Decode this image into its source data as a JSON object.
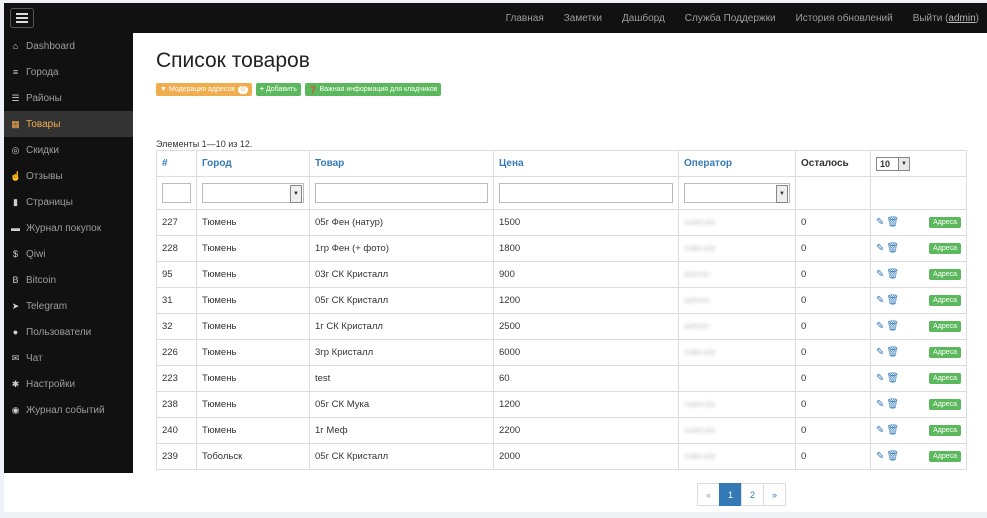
{
  "topbar": {
    "nav": [
      {
        "label": "Главная"
      },
      {
        "label": "Заметки"
      },
      {
        "label": "Дашборд"
      },
      {
        "label": "Служба Поддержки"
      },
      {
        "label": "История обновлений"
      }
    ],
    "logout": "Выйти",
    "user": "admin"
  },
  "sidebar": {
    "items": [
      {
        "label": "Dashboard",
        "icon": "home-icon",
        "glyph": "⌂",
        "active": false
      },
      {
        "label": "Города",
        "icon": "list-icon",
        "glyph": "≡",
        "active": false
      },
      {
        "label": "Районы",
        "icon": "list-icon",
        "glyph": "☰",
        "active": false
      },
      {
        "label": "Товары",
        "icon": "grid-icon",
        "glyph": "▦",
        "active": true
      },
      {
        "label": "Скидки",
        "icon": "coins-icon",
        "glyph": "◎",
        "active": false
      },
      {
        "label": "Отзывы",
        "icon": "thumbs-up-icon",
        "glyph": "☝",
        "active": false
      },
      {
        "label": "Страницы",
        "icon": "file-icon",
        "glyph": "▮",
        "active": false
      },
      {
        "label": "Журнал покупок",
        "icon": "cart-icon",
        "glyph": "▬",
        "active": false
      },
      {
        "label": "Qiwi",
        "icon": "dollar-icon",
        "glyph": "$",
        "active": false
      },
      {
        "label": "Bitcoin",
        "icon": "bitcoin-icon",
        "glyph": "B",
        "active": false
      },
      {
        "label": "Telegram",
        "icon": "send-icon",
        "glyph": "➤",
        "active": false
      },
      {
        "label": "Пользователи",
        "icon": "user-icon",
        "glyph": "●",
        "active": false
      },
      {
        "label": "Чат",
        "icon": "envelope-icon",
        "glyph": "✉",
        "active": false
      },
      {
        "label": "Настройки",
        "icon": "gear-icon",
        "glyph": "✱",
        "active": false
      },
      {
        "label": "Журнал событий",
        "icon": "eye-icon",
        "glyph": "◉",
        "active": false
      }
    ]
  },
  "main": {
    "title": "Список товаров",
    "buttons": {
      "moderation": "Модерация адресов",
      "moderation_count": "0",
      "add": "Добавить",
      "info": "Важная информация для кладчиков"
    },
    "summary": "Элементы 1—10 из 12.",
    "table": {
      "headers": [
        "#",
        "Город",
        "Товар",
        "Цена",
        "Оператор",
        "Осталось"
      ],
      "per_page": "10",
      "address_label": "Адреса",
      "rows": [
        {
          "id": "227",
          "city": "Тюмень",
          "product": "05г Фен (натур)",
          "price": "1500",
          "operator": "nakrula",
          "left": "0"
        },
        {
          "id": "228",
          "city": "Тюмень",
          "product": "1гр Фен (+ фото)",
          "price": "1800",
          "operator": "nakrula",
          "left": "0"
        },
        {
          "id": "95",
          "city": "Тюмень",
          "product": "03г СК Кристалл",
          "price": "900",
          "operator": "admin",
          "left": "0"
        },
        {
          "id": "31",
          "city": "Тюмень",
          "product": "05г СК Кристалл",
          "price": "1200",
          "operator": "admin",
          "left": "0"
        },
        {
          "id": "32",
          "city": "Тюмень",
          "product": "1г СК Кристалл",
          "price": "2500",
          "operator": "admin",
          "left": "0"
        },
        {
          "id": "226",
          "city": "Тюмень",
          "product": "3гр Кристалл",
          "price": "6000",
          "operator": "nakrula",
          "left": "0"
        },
        {
          "id": "223",
          "city": "Тюмень",
          "product": "test",
          "price": "60",
          "operator": "",
          "left": "0"
        },
        {
          "id": "238",
          "city": "Тюмень",
          "product": "05г СК Мука",
          "price": "1200",
          "operator": "nakrula",
          "left": "0"
        },
        {
          "id": "240",
          "city": "Тюмень",
          "product": "1г Меф",
          "price": "2200",
          "operator": "nakrula",
          "left": "0"
        },
        {
          "id": "239",
          "city": "Тобольск",
          "product": "05г СК Кристалл",
          "price": "2000",
          "operator": "nakrula",
          "left": "0"
        }
      ]
    },
    "pagination": {
      "prev": "«",
      "pages": [
        "1",
        "2"
      ],
      "current": "1",
      "next": "»"
    }
  }
}
